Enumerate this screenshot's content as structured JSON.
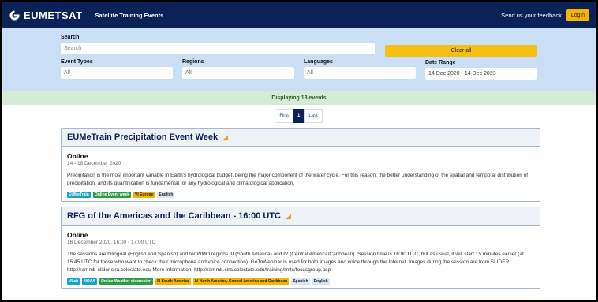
{
  "nav": {
    "brand": "EUMETSAT",
    "subtitle": "Satellite Training Events",
    "feedback": "Send us your feedback",
    "login": "Login"
  },
  "filters": {
    "search_label": "Search",
    "search_placeholder": "Search",
    "clear_all": "Clear all",
    "event_types_label": "Event Types",
    "event_types_value": "All",
    "regions_label": "Regions",
    "regions_value": "All",
    "languages_label": "Languages",
    "languages_value": "All",
    "date_range_label": "Date Range",
    "date_range_value": "14 Dec 2020 - 14 Dec 2023"
  },
  "results": {
    "count_text": "Displaying 18 events"
  },
  "pagination": {
    "first": "First",
    "current": "1",
    "last": "Last"
  },
  "events": [
    {
      "title": "EUMeTrain Precipitation Event Week",
      "mode": "Online",
      "date": "14 - 18 December 2020",
      "description": "Precipitation is the most important variable in Earth's hydrological budget, being the major component of the water cycle. For this reason, the better understanding of the spatial and temporal distribution of precipitation, and its quantification is fundamental for any hydrological and climatological application.",
      "tags": [
        {
          "label": "EUMeTrain",
          "color": "#1aa3c8",
          "text": "#fff"
        },
        {
          "label": "Online Event week",
          "color": "#2e9b45",
          "text": "#fff"
        },
        {
          "label": "VI Europe",
          "color": "#f4b400",
          "text": "#222"
        },
        {
          "label": "English",
          "color": "#d8e6f3",
          "text": "#222"
        }
      ]
    },
    {
      "title": "RFG of the Americas and the Caribbean - 16:00 UTC",
      "mode": "Online",
      "date": "16 December 2020, 16:00 - 17:00 UTC",
      "description": "The sessions are bilingual (English and Spanish) and for WMO regions III (South America) and IV (Central America/Caribbean). Session time is 16:00 UTC, but as usual, it will start 15 minutes earlier (at 15:45 UTC for those who want to check their microphone and voice connection). GoToWebinar is used for both images and voice through the Internet. Images during the session are from SLIDER: http://rammb-slider.cira.colostate.edu More Information: http://rammb.cira.colostate.edu/training/rmtc/focusgroup.asp",
      "tags": [
        {
          "label": "VLab",
          "color": "#1aa3c8",
          "text": "#fff"
        },
        {
          "label": "NOAA",
          "color": "#1aa3c8",
          "text": "#fff"
        },
        {
          "label": "Online Weather discussion",
          "color": "#2e9b45",
          "text": "#fff"
        },
        {
          "label": "III South America",
          "color": "#f4b400",
          "text": "#222"
        },
        {
          "label": "IV North America, Central America and Caribbean",
          "color": "#f4b400",
          "text": "#222"
        },
        {
          "label": "Spanish",
          "color": "#d8e6f3",
          "text": "#222"
        },
        {
          "label": "English",
          "color": "#d8e6f3",
          "text": "#222"
        }
      ]
    }
  ]
}
